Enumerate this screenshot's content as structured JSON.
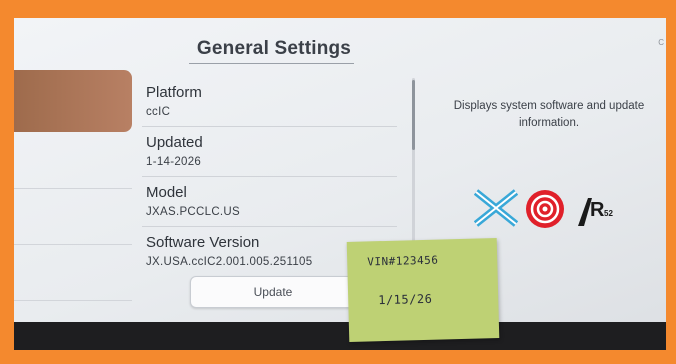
{
  "header": {
    "title": "General Settings",
    "corner_text": "C"
  },
  "info_rows": [
    {
      "label": "Platform",
      "value": "ccIC"
    },
    {
      "label": "Updated",
      "value": "1-14-2026"
    },
    {
      "label": "Model",
      "value": "JXAS.PCCLC.US"
    },
    {
      "label": "Software Version",
      "value": "JX.USA.ccIC2.001.005.251105"
    }
  ],
  "update_button": {
    "label": "Update"
  },
  "description": "Displays system software and update information.",
  "certification_logos": [
    "cross-mark-icon",
    "red-dot-award-icon",
    "ir52-award-icon"
  ],
  "sticky_note": {
    "line1": "VIN#123456",
    "line2": "1/15/26"
  },
  "colors": {
    "frame": "#f4892e",
    "sidebar_selected": "#a87155",
    "sticky_note": "#bed174"
  }
}
